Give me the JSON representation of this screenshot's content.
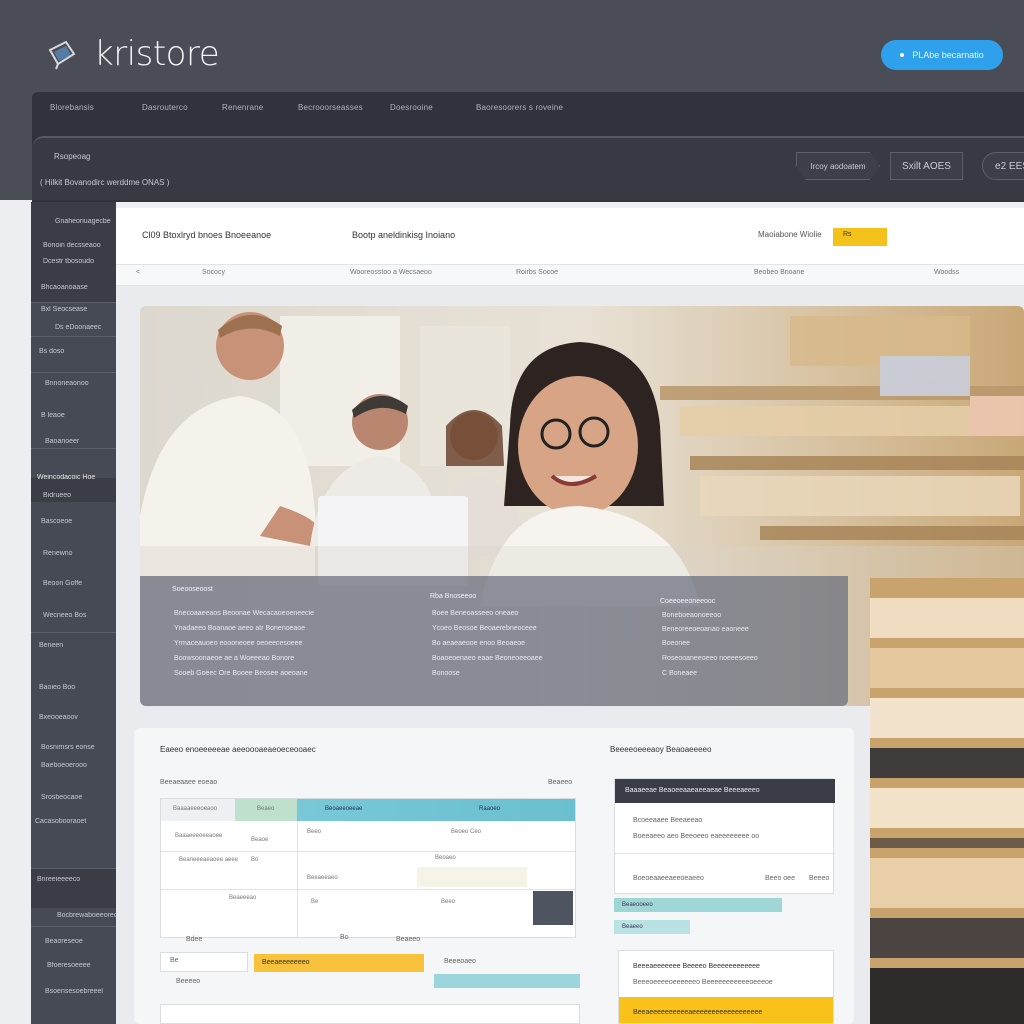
{
  "brand": {
    "name": "kristore"
  },
  "header": {
    "cta_label": "PLAbe becarnatio"
  },
  "nav": {
    "items": [
      "Blorebansis",
      "Dasrouterco",
      "Renenrane",
      "Becrooorseasses",
      "Doesrooine",
      "Baoresoorers s roveine"
    ]
  },
  "subbar": {
    "title": "Rsopeoag",
    "breadcrumb": "( Hilkit Bovanodirc werddme ONAS )",
    "btn1": "Ircoy aodoatem",
    "btn2": "Sxilt AOES",
    "btn3": "e2 EES"
  },
  "sidebar": {
    "items": [
      "Gnaheoriuagecbe",
      "Bonoin decsseaoo",
      "Dcestr tbosoudo",
      "Bhcaoanoaase",
      "Bxl Seocsease",
      "Ds eDoonaeec",
      "Bs doso",
      "Bnnoneaonoo",
      "B leaoe",
      "Baoanoeer",
      "Weincodacoic Hoe",
      "Bidrueeo",
      "Bascoeoe",
      "Renewno",
      "Beoon Goffe",
      "Wecneeo Bos",
      "Beneen",
      "Baoieo Boo",
      "Bxeooeaoov",
      "Bosnimsrs eonse",
      "Baeboeoerooo",
      "Srosbeocaoe",
      "Cacasobooraoet",
      "Bnreeieeeeco",
      "Bocbrewaboeeoreo",
      "Beaoreseoe",
      "Bfoeresoeeee",
      "Bsoensesoebreeel"
    ]
  },
  "main": {
    "strip": [
      "Cl09 Btoxlryd bnoes Bnoeeanoe",
      "Bootp aneldinkisg Inoiano",
      "Maoiabone Wiolie"
    ],
    "badge": "Rs",
    "tabs": [
      "<",
      "Sococy",
      "Wooreosstoo a Wecsaeoo",
      "Roirbs Socoe",
      "Beobeo Bnoane",
      "Woodss"
    ]
  },
  "hero_overlay": {
    "col1_head": "Soeooseoost",
    "col1": [
      "Bnecoaaeeaos Beoonae Wecacaoeoeneecie",
      "Ynadaeeo Boanaoe aeeo atr Bonenoeaoe",
      "Yrmaceauoeo eoooneoee oeoeecesoeee",
      "Boowsoonaeoe ae a Woeeeao Bonore",
      "Sooeb Goeec Ore Booee Beosee aoeoane"
    ],
    "col2_head": "Rba Bnoseeoo",
    "col2": [
      "Boee Beneoasseeo oneaeo",
      "Ycoeo Beosoe Beoaerebneoceee",
      "Bo aeaeaeooe enoo Beoaeoe",
      "Boaoeoenaeo eaae Beoneoeeoaee",
      "Bonoose"
    ],
    "col3_head": "Coeeoeeoneeooc",
    "col3": [
      "Boneboeaonoeeoo",
      "Beneoreeoeoanao eaoneee",
      "Boeonee",
      "Roseooaneeoeeo noeeesoeeo",
      "C Boneaee"
    ]
  },
  "panel": {
    "title": "Eaeeo enoeeeeeae aeeoooaeaeoeceooaec",
    "right_title": "Beeeeoeeeaoy Beaoaeeeeo",
    "table_title": "Beeaeaaee eoeao",
    "table_count": "Beaeeo",
    "table_headers": [
      "Baaaaeeeoeaoo",
      "Beaeo",
      "Beoaeeoeeae",
      "Raaoeo"
    ],
    "table_rows": [
      [
        "Baaaeeeoeeaoee",
        "Beaoe",
        "Beeo",
        "Beoeo Ceo"
      ],
      [
        "Beaneeeaeaoee aeee",
        "Bo",
        "Beoaeo",
        ""
      ],
      [
        "",
        "",
        "Beeaeeaeo",
        ""
      ],
      [
        "",
        "Beaeeeao",
        "Be",
        "Beeo"
      ]
    ],
    "badge_row": [
      "Bdee",
      "Bo",
      "Beaeeo",
      "Be"
    ],
    "footer_rows": [
      "Beeaeeeeeeeo",
      "Beeeoaeo",
      "Beeeeo"
    ]
  },
  "right_card": {
    "head": "Baaaeeae Beaoeeaaeaeeaeae Beeeaeeeo",
    "line1": "Bcoeeaaee Beeaeeao",
    "line2": "Boeeaeeo aeo Beeoeeo eaeeeeeeee oo",
    "foot_left": "Boeoeaaeeaeeoeaeeo",
    "foot_mid": "Beeo oee",
    "foot_right": "Beeeo",
    "chips": [
      "Beaeooeeo",
      "Beaeeo",
      "Beaeeoaeoeee",
      "Beeaeeeo"
    ]
  },
  "card2": {
    "title": "Beeeaeeeeeee Beeeeo Beeeeeeeeeeee",
    "line": "Beeeoeeeeoeeeeeeo Beeeeeeeeeeeoeeeoe",
    "bar": "Beeaeeeeeeeeeeaeeeeeeeeeeeeeeeeee"
  },
  "colors": {
    "header": "#4a4d56",
    "nav": "#30333b",
    "accent": "#2ea0ec",
    "badge": "#f5c21b",
    "teal": "#6bbfcf"
  }
}
